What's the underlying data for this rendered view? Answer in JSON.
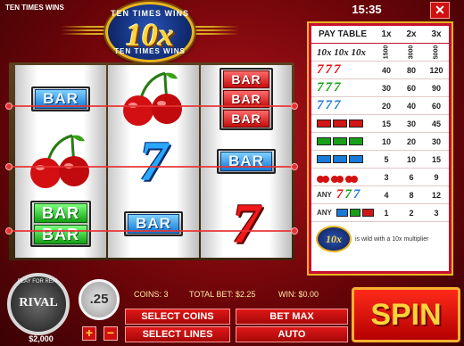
{
  "game_title": "TEN TIMES WINS",
  "logo": {
    "top_text": "TEN TIMES WINS",
    "big_text": "10x",
    "bottom_text": "TEN TIMES WINS"
  },
  "reels": {
    "reel1": {
      "top": "BAR",
      "bottom1": "BAR",
      "bottom2": "BAR"
    },
    "reel2": {
      "middle": "7",
      "bottom": "BAR"
    },
    "reel3": {
      "top1": "BAR",
      "top2": "BAR",
      "top3": "BAR",
      "middle": "BAR",
      "bottom": "7"
    }
  },
  "clock": "15:35",
  "close_label": "✕",
  "paytable": {
    "title": "PAY TABLE",
    "columns": [
      "1x",
      "2x",
      "3x"
    ],
    "rows": [
      {
        "symbol": "10x 10x 10x",
        "values": [
          "1500",
          "3000",
          "5000"
        ]
      },
      {
        "symbol": "red-seven",
        "values": [
          "40",
          "80",
          "120"
        ]
      },
      {
        "symbol": "green-seven",
        "values": [
          "30",
          "60",
          "90"
        ]
      },
      {
        "symbol": "blue-seven",
        "values": [
          "20",
          "40",
          "60"
        ]
      },
      {
        "symbol": "triple-bar",
        "values": [
          "15",
          "30",
          "45"
        ]
      },
      {
        "symbol": "double-bar",
        "values": [
          "10",
          "20",
          "30"
        ]
      },
      {
        "symbol": "single-bar",
        "values": [
          "5",
          "10",
          "15"
        ]
      },
      {
        "symbol": "cherry",
        "values": [
          "3",
          "6",
          "9"
        ]
      },
      {
        "symbol": "any-seven",
        "label": "ANY",
        "values": [
          "4",
          "8",
          "12"
        ]
      },
      {
        "symbol": "any-bar",
        "label": "ANY",
        "values": [
          "1",
          "2",
          "3"
        ]
      }
    ],
    "wild_badge": "10x",
    "wild_text": "is wild with a 10x multiplier"
  },
  "bottom": {
    "play_for_real": "PLAY FOR REAL",
    "rival": "RIVAL",
    "balance": "$2,000",
    "coin_value": ".25",
    "plus": "+",
    "minus": "−",
    "coins": "COINS: 3",
    "total_bet": "TOTAL BET: $2.25",
    "win": "WIN: $0.00",
    "select_coins": "SELECT COINS",
    "bet_max": "BET MAX",
    "select_lines": "SELECT LINES",
    "auto": "AUTO",
    "spin": "SPIN"
  }
}
